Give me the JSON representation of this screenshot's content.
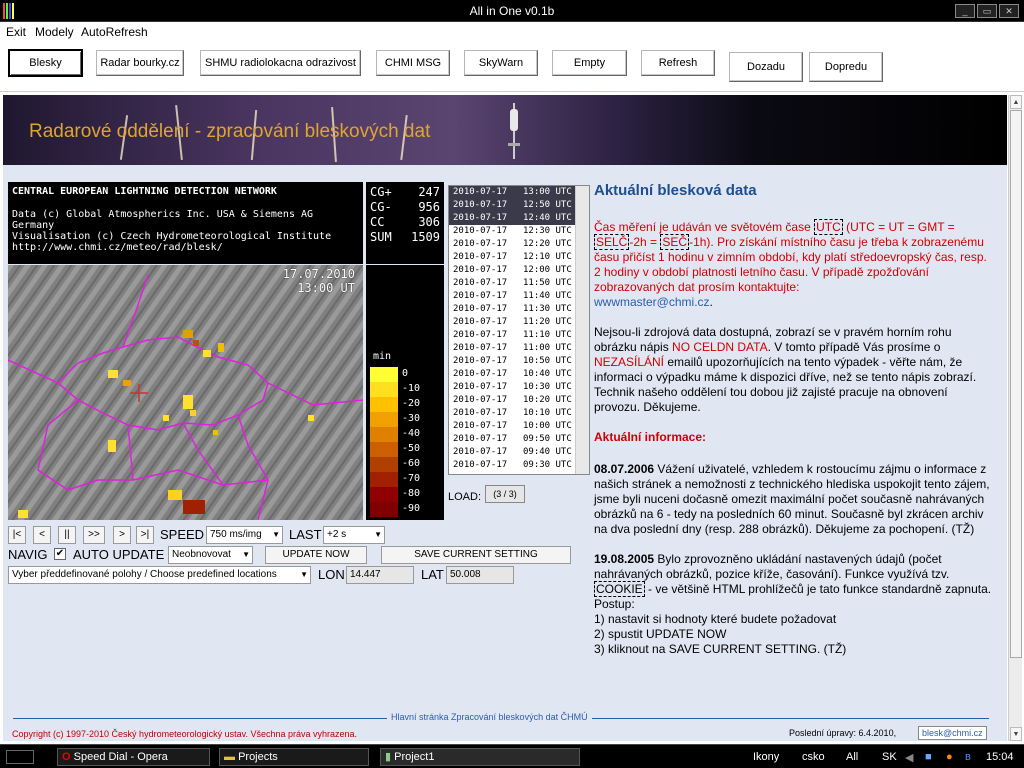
{
  "window": {
    "title": "All in One  v0.1b"
  },
  "menu": [
    "Exit",
    "Modely",
    "AutoRefresh"
  ],
  "toolbar": {
    "buttons": [
      "Blesky",
      "Radar bourky.cz",
      "SHMU radiolokacna odrazivost",
      "CHMI MSG",
      "SkyWarn",
      "Empty",
      "Refresh",
      "Dozadu",
      "Dopredu"
    ]
  },
  "banner": {
    "text": "Radarové oddělení - zpracování bleskových dat"
  },
  "network": {
    "title": "CENTRAL EUROPEAN LIGHTNING DETECTION NETWORK",
    "line1": "Data (c) Global Atmospherics Inc. USA & Siemens AG Germany",
    "line2": "Visualisation (c) Czech Hydrometeorological Institute",
    "line3": "http://www.chmi.cz/meteo/rad/blesk/"
  },
  "counts": [
    {
      "label": "CG+",
      "value": "247"
    },
    {
      "label": "CG-",
      "value": "956"
    },
    {
      "label": "CC",
      "value": "306"
    },
    {
      "label": "SUM",
      "value": "1509"
    }
  ],
  "map": {
    "date": "17.07.2010",
    "time": "13:00 UT"
  },
  "legend": {
    "title": "min",
    "levels": [
      "0",
      "-10",
      "-20",
      "-30",
      "-40",
      "-50",
      "-60",
      "-70",
      "-80",
      "-90"
    ],
    "colors": [
      "#ffff33",
      "#ffe020",
      "#ffc000",
      "#f0a000",
      "#e08000",
      "#cc6000",
      "#b04000",
      "#a02000",
      "#900000",
      "#800000"
    ]
  },
  "times": [
    {
      "date": "2010-07-17",
      "time": "13:00 UTC"
    },
    {
      "date": "2010-07-17",
      "time": "12:50 UTC"
    },
    {
      "date": "2010-07-17",
      "time": "12:40 UTC"
    },
    {
      "date": "2010-07-17",
      "time": "12:30 UTC"
    },
    {
      "date": "2010-07-17",
      "time": "12:20 UTC"
    },
    {
      "date": "2010-07-17",
      "time": "12:10 UTC"
    },
    {
      "date": "2010-07-17",
      "time": "12:00 UTC"
    },
    {
      "date": "2010-07-17",
      "time": "11:50 UTC"
    },
    {
      "date": "2010-07-17",
      "time": "11:40 UTC"
    },
    {
      "date": "2010-07-17",
      "time": "11:30 UTC"
    },
    {
      "date": "2010-07-17",
      "time": "11:20 UTC"
    },
    {
      "date": "2010-07-17",
      "time": "11:10 UTC"
    },
    {
      "date": "2010-07-17",
      "time": "11:00 UTC"
    },
    {
      "date": "2010-07-17",
      "time": "10:50 UTC"
    },
    {
      "date": "2010-07-17",
      "time": "10:40 UTC"
    },
    {
      "date": "2010-07-17",
      "time": "10:30 UTC"
    },
    {
      "date": "2010-07-17",
      "time": "10:20 UTC"
    },
    {
      "date": "2010-07-17",
      "time": "10:10 UTC"
    },
    {
      "date": "2010-07-17",
      "time": "10:00 UTC"
    },
    {
      "date": "2010-07-17",
      "time": "09:50 UTC"
    },
    {
      "date": "2010-07-17",
      "time": "09:40 UTC"
    },
    {
      "date": "2010-07-17",
      "time": "09:30 UTC"
    }
  ],
  "load": {
    "label": "LOAD:",
    "value": "(3 / 3)"
  },
  "player": {
    "first": "|<",
    "prev": "<",
    "pause": "||",
    "ff": ">>",
    "next": ">",
    "last": ">|",
    "speed_label": "SPEED",
    "speed_value": "750 ms/img",
    "last_label": "LAST",
    "last_value": "+2 s"
  },
  "navig": {
    "label": "NAVIG",
    "checked": "✔",
    "auto_label": "AUTO UPDATE",
    "auto_value": "Neobnovovat",
    "update_now": "UPDATE NOW",
    "save": "SAVE CURRENT SETTING"
  },
  "location": {
    "placeholder": "Vyber předdefinované polohy / Choose predefined locations",
    "lon_label": "LON",
    "lon": "14.447",
    "lat_label": "LAT",
    "lat": "50.008"
  },
  "article": {
    "heading": "Aktuální blesková data",
    "p1a": "Čas měření je udáván ve světovém čase ",
    "utc": "UTC",
    "p1b": " (UTC = UT = GMT = ",
    "selc": "SELČ",
    "p1c": "-2h = ",
    "sec": "SEČ",
    "p1d": "-1h). Pro získání místního času je třeba k zobrazenému času přičíst 1 hodinu v zimním období, kdy platí středoevropský čas, resp. 2 hodiny v období platnosti letního času. V případě zpožďování zobrazovaných dat prosím kontaktujte:",
    "email": "wwwmaster@chmi.cz",
    "p2a": "Nejsou-li zdrojová data dostupná, zobrazí se v pravém horním rohu obrázku nápis ",
    "nodata": "NO CELDN DATA",
    "p2b": ". V tomto případě Vás prosíme o ",
    "nezasilani": "NEZASÍLÁNÍ",
    "p2c": " emailů upozorňujících na tento výpadek - věřte nám, že informaci o výpadku máme k dispozici dříve, než se tento nápis zobrazí. Technik našeho oddělení tou dobou již zajisté pracuje na obnovení provozu. Děkujeme.",
    "info_heading": "Aktuální informace:",
    "d1": "08.07.2006",
    "t1": " Vážení uživatelé, vzhledem k rostoucímu zájmu o informace z našich stránek a nemožnosti z technického hlediska uspokojit tento zájem, jsme byli nuceni dočasně omezit maximální počet současně nahrávaných obrázků na 6 - tedy na posledních 60 minut. Současně byl zkrácen archiv na dva poslední dny (resp. 288 obrázků). Děkujeme za pochopení. (TŽ)",
    "d2": "19.08.2005",
    "t2a": " Bylo zprovozněno ukládání nastavených údajů (počet nahrávaných obrázků, pozice kříže, časování). Funkce využívá tzv. ",
    "cookie": "COOKIE",
    "t2b": " - ve většině HTML prohlížečů je tato funkce standardně zapnuta.",
    "postup": "Postup:",
    "s1": "1) nastavit si hodnoty které budete požadovat",
    "s2": "2) spustit UPDATE NOW",
    "s3": "3) kliknout na SAVE CURRENT SETTING. (TŽ)"
  },
  "footer": {
    "link": "Hlavní stránka Zpracování bleskových dat ČHMÚ",
    "copyright": "Copyright (c) 1997-2010 Český hydrometeorologický ustav. Všechna práva vyhrazena.",
    "updated": "Poslední úpravy: 6.4.2010,",
    "mail": "blesk@chmi.cz"
  },
  "taskbar": {
    "tasks": [
      "Speed Dial - Opera",
      "Projects",
      "Project1"
    ],
    "tray": [
      "Ikony",
      "csko",
      "All",
      "SK"
    ],
    "clock": "15:04"
  }
}
